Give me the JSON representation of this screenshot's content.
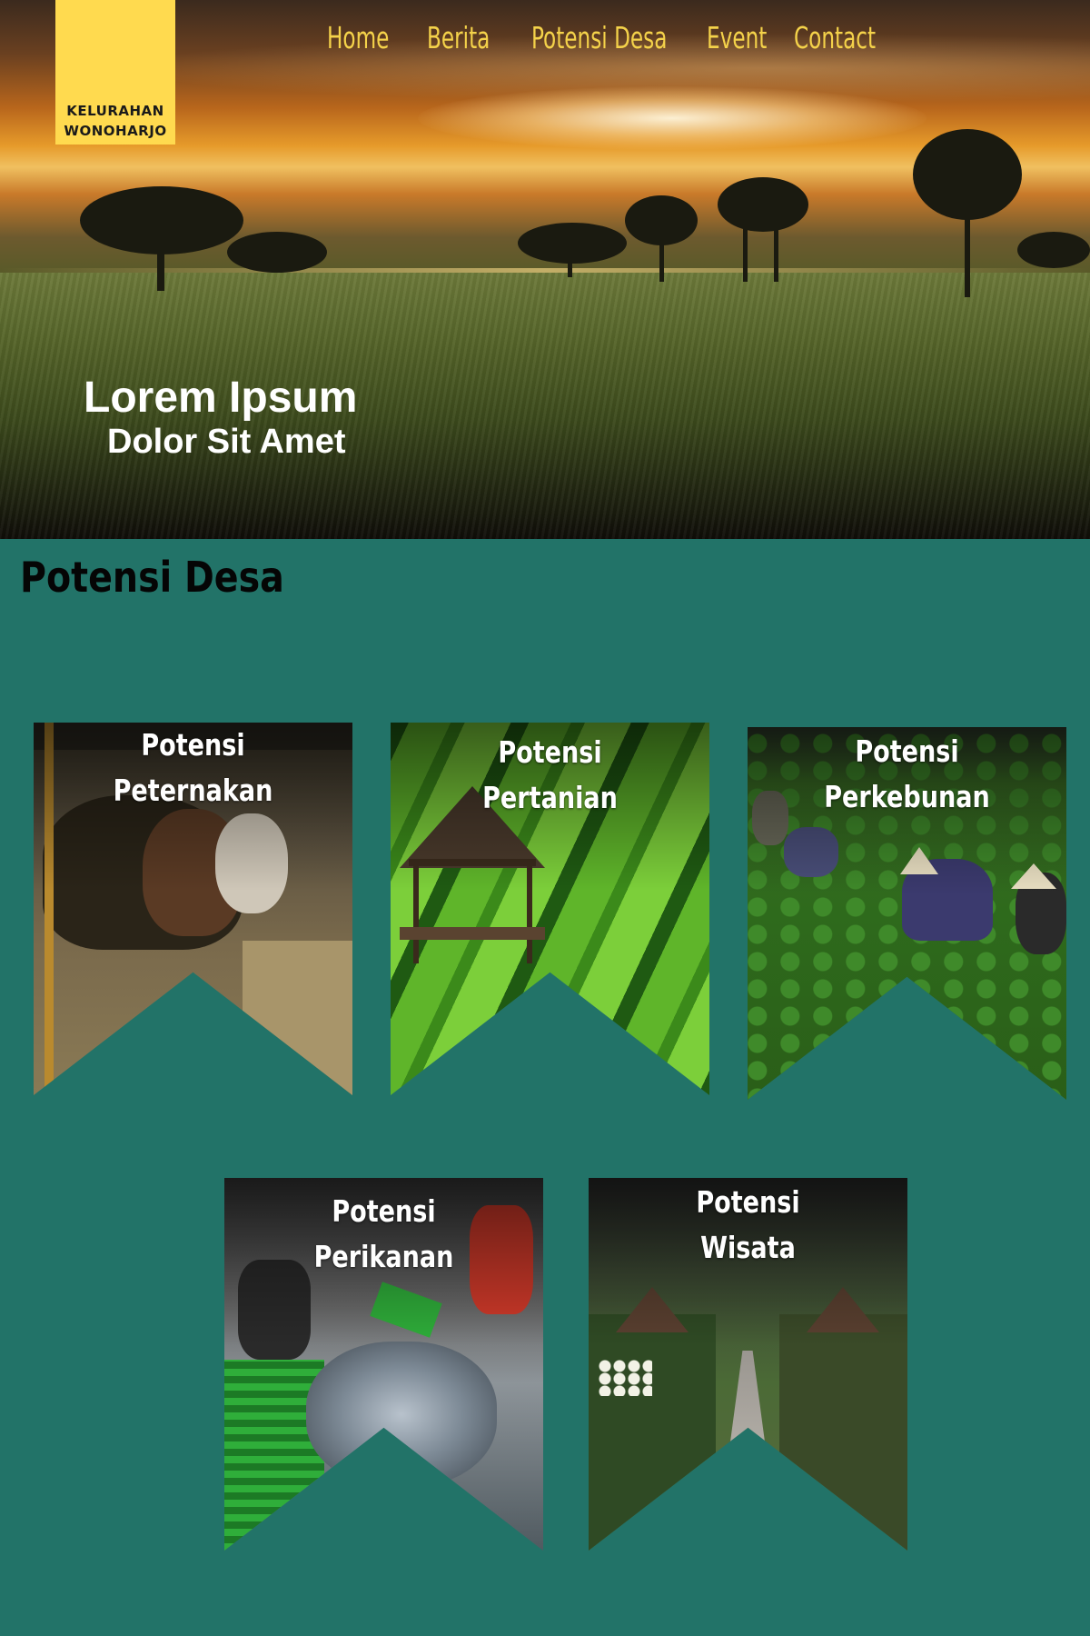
{
  "logo": {
    "line1": "KELURAHAN",
    "line2": "WONOHARJO"
  },
  "nav": {
    "items": [
      {
        "label": "Home"
      },
      {
        "label": "Berita"
      },
      {
        "label": "Potensi Desa"
      },
      {
        "label": "Event"
      },
      {
        "label": "Contact"
      }
    ]
  },
  "hero": {
    "title": "Lorem Ipsum",
    "subtitle": "Dolor Sit Amet"
  },
  "section": {
    "title": "Potensi Desa",
    "cards": [
      {
        "line1": "Potensi",
        "line2": "Peternakan"
      },
      {
        "line1": "Potensi",
        "line2": "Pertanian"
      },
      {
        "line1": "Potensi",
        "line2": "Perkebunan"
      },
      {
        "line1": "Potensi",
        "line2": "Perikanan"
      },
      {
        "line1": "Potensi",
        "line2": "Wisata"
      }
    ]
  },
  "colors": {
    "background": "#227368",
    "logo_bg": "#ffda4f",
    "nav_text": "#f4d24a",
    "hero_text": "#ffffff",
    "section_title": "#050505"
  }
}
